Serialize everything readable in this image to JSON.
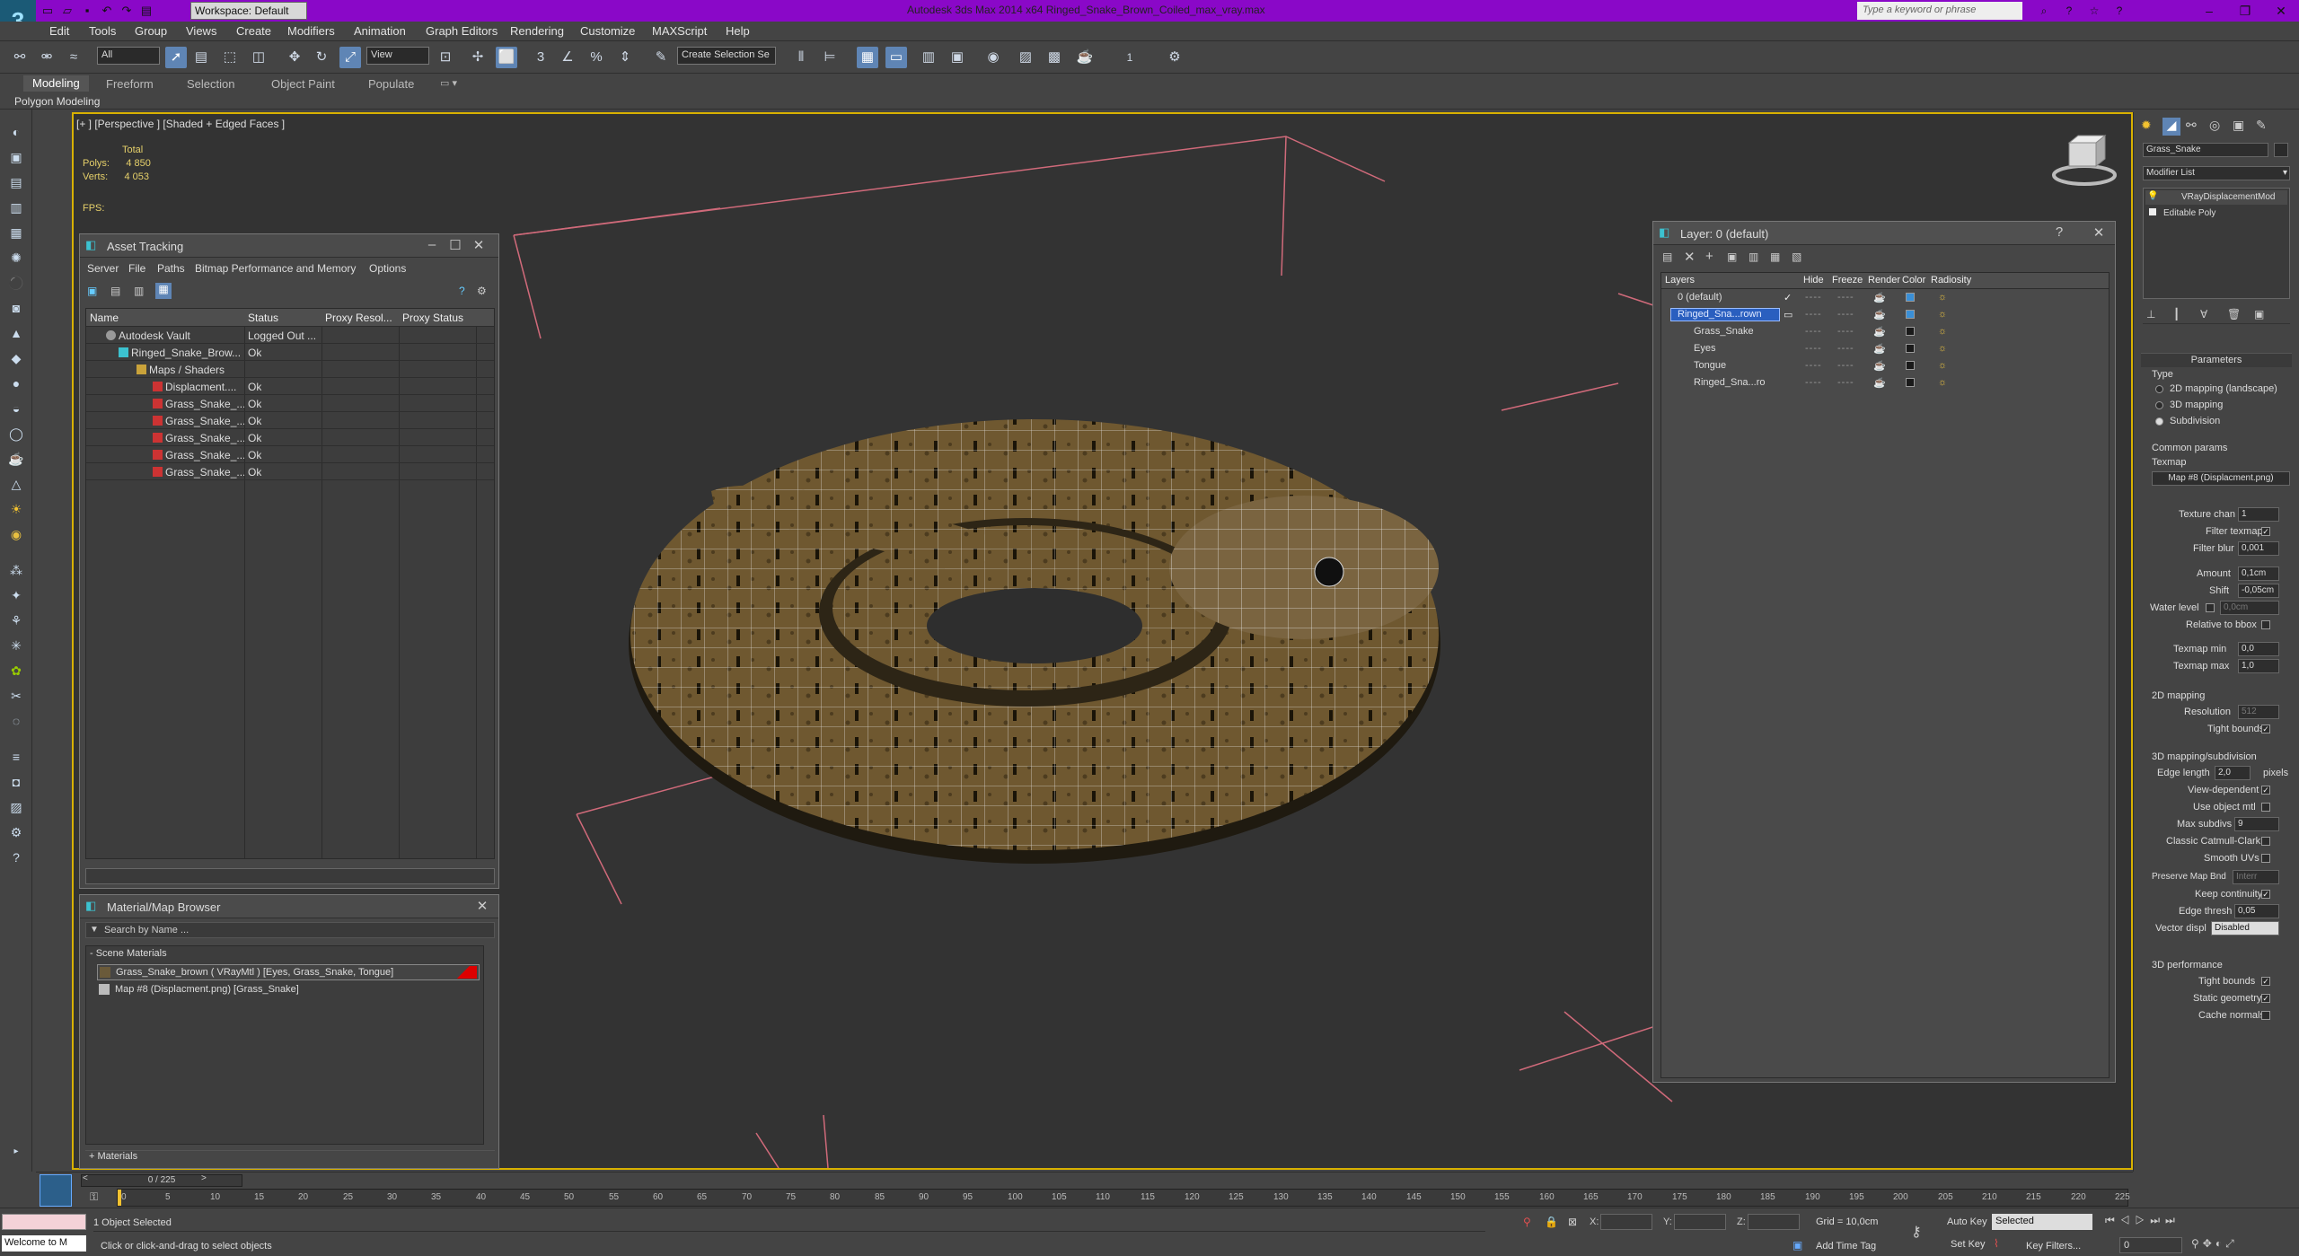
{
  "app": {
    "title": "Autodesk 3ds Max  2014 x64     Ringed_Snake_Brown_Coiled_max_vray.max",
    "workspace": "Workspace: Default",
    "search_placeholder": "Type a keyword or phrase"
  },
  "menu": [
    "Edit",
    "Tools",
    "Group",
    "Views",
    "Create",
    "Modifiers",
    "Animation",
    "Graph Editors",
    "Rendering",
    "Customize",
    "MAXScript",
    "Help"
  ],
  "toolbar": {
    "filter": "All",
    "refcoord": "View",
    "selection_set": "Create Selection Se",
    "count": "1"
  },
  "ribbon": {
    "tabs": [
      "Modeling",
      "Freeform",
      "Selection",
      "Object Paint",
      "Populate"
    ],
    "subtitle": "Polygon Modeling"
  },
  "viewport": {
    "label": "[+ ] [Perspective ] [Shaded + Edged Faces ]",
    "stats_total": "Total",
    "polys_label": "Polys:",
    "polys": "4 850",
    "verts_label": "Verts:",
    "verts": "4 053",
    "fps_label": "FPS:"
  },
  "asset_tracking": {
    "title": "Asset Tracking",
    "menu": [
      "Server",
      "File",
      "Paths",
      "Bitmap Performance and Memory",
      "Options"
    ],
    "columns": [
      "Name",
      "Status",
      "Proxy Resol...",
      "Proxy Status"
    ],
    "rows": [
      {
        "name": "Autodesk Vault",
        "status": "Logged Out ..."
      },
      {
        "name": "Ringed_Snake_Brow...",
        "status": "Ok"
      },
      {
        "name": "Maps / Shaders",
        "status": ""
      },
      {
        "name": "Displacment....",
        "status": "Ok"
      },
      {
        "name": "Grass_Snake_...",
        "status": "Ok"
      },
      {
        "name": "Grass_Snake_...",
        "status": "Ok"
      },
      {
        "name": "Grass_Snake_...",
        "status": "Ok"
      },
      {
        "name": "Grass_Snake_...",
        "status": "Ok"
      },
      {
        "name": "Grass_Snake_...",
        "status": "Ok"
      }
    ]
  },
  "material_browser": {
    "title": "Material/Map Browser",
    "search": "Search by Name ...",
    "group": "- Scene Materials",
    "items": [
      "Grass_Snake_brown  ( VRayMtl ) [Eyes, Grass_Snake, Tongue]",
      "Map #8 (Displacment.png)  [Grass_Snake]"
    ],
    "footer": "+ Materials"
  },
  "layers": {
    "title": "Layer: 0 (default)",
    "columns": [
      "Layers",
      "Hide",
      "Freeze",
      "Render",
      "Color",
      "Radiosity"
    ],
    "rows": [
      {
        "name": "0 (default)",
        "color": "#3a8fd6"
      },
      {
        "name": "Ringed_Sna...rown",
        "color": "#3a8fd6"
      },
      {
        "name": "Grass_Snake",
        "color": "#1a1a1a"
      },
      {
        "name": "Eyes",
        "color": "#1a1a1a"
      },
      {
        "name": "Tongue",
        "color": "#1a1a1a"
      },
      {
        "name": "Ringed_Sna...ro",
        "color": "#1a1a1a"
      }
    ],
    "dashes": "----"
  },
  "command_panel": {
    "object_name": "Grass_Snake",
    "modifier_list": "Modifier List",
    "stack": [
      "VRayDisplacementMod",
      "Editable Poly"
    ],
    "params_title": "Parameters",
    "type_label": "Type",
    "type_options": [
      "2D mapping (landscape)",
      "3D mapping",
      "Subdivision"
    ],
    "common_params": "Common params",
    "texmap_label": "Texmap",
    "texmap": "Map #8 (Displacment.png)",
    "texture_chan_label": "Texture chan",
    "texture_chan": "1",
    "filter_texmap": "Filter texmap",
    "filter_blur_label": "Filter blur",
    "filter_blur": "0,001",
    "amount_label": "Amount",
    "amount": "0,1cm",
    "shift_label": "Shift",
    "shift": "-0,05cm",
    "water_label": "Water level",
    "water": "0,0cm",
    "relative_bbox": "Relative to bbox",
    "texmap_min_label": "Texmap min",
    "texmap_min": "0,0",
    "texmap_max_label": "Texmap max",
    "texmap_max": "1,0",
    "mapping2d": "2D mapping",
    "resolution_label": "Resolution",
    "resolution": "512",
    "tight_bounds": "Tight bounds",
    "mapping3d": "3D mapping/subdivision",
    "edge_length_label": "Edge length",
    "edge_length": "2,0",
    "pixels": "pixels",
    "view_dependent": "View-dependent",
    "use_object_mtl": "Use object mtl",
    "max_subdivs_label": "Max subdivs",
    "max_subdivs": "9",
    "classic_catmull": "Classic Catmull-Clark",
    "smooth_uvs": "Smooth UVs",
    "preserve_map_label": "Preserve Map Bnd",
    "preserve_map": "Interr",
    "keep_continuity": "Keep continuity",
    "edge_thresh_label": "Edge thresh",
    "edge_thresh": "0,05",
    "vector_disp_label": "Vector displ",
    "vector_disp": "Disabled",
    "performance": "3D performance",
    "tight_bounds2": "Tight bounds",
    "static_geometry": "Static geometry",
    "cache_normals": "Cache normals"
  },
  "timeline": {
    "frame": "0 / 225",
    "ticks": [
      "0",
      "5",
      "10",
      "15",
      "20",
      "25",
      "30",
      "35",
      "40",
      "45",
      "50",
      "55",
      "60",
      "65",
      "70",
      "75",
      "80",
      "85",
      "90",
      "95",
      "100",
      "105",
      "110",
      "115",
      "120",
      "125",
      "130",
      "135",
      "140",
      "145",
      "150",
      "155",
      "160",
      "165",
      "170",
      "175",
      "180",
      "185",
      "190",
      "195",
      "200",
      "205",
      "210",
      "215",
      "220",
      "225"
    ]
  },
  "statusbar": {
    "listener": "Welcome to M",
    "selected": "1 Object Selected",
    "prompt": "Click or click-and-drag to select objects",
    "x_label": "X:",
    "y_label": "Y:",
    "z_label": "Z:",
    "grid": "Grid = 10,0cm",
    "add_time_tag": "Add Time Tag",
    "auto_key": "Auto Key",
    "auto_key_mode": "Selected",
    "set_key": "Set Key",
    "key_filters": "Key Filters...",
    "frame_field": "0"
  }
}
